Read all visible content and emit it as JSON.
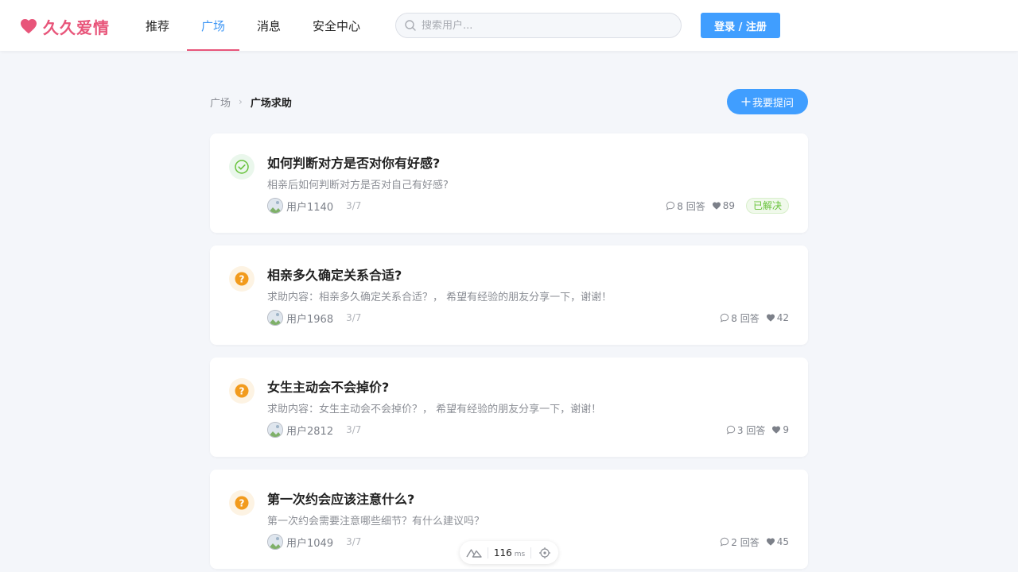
{
  "brand": {
    "name": "久久爱情",
    "color": "#e8557a",
    "icon": "heart-icon"
  },
  "nav": {
    "items": [
      {
        "label": "推荐"
      },
      {
        "label": "广场",
        "active": true
      },
      {
        "label": "消息"
      },
      {
        "label": "安全中心"
      }
    ]
  },
  "search": {
    "placeholder": "搜索用户...",
    "value": ""
  },
  "auth": {
    "login_label": "登录 / 注册"
  },
  "breadcrumb": {
    "root": "广场",
    "current": "广场求助"
  },
  "ask_button": {
    "label": "我要提问"
  },
  "questions": [
    {
      "status": "solved",
      "title": "如何判断对方是否对你有好感?",
      "desc": "相亲后如何判断对方是否对自己有好感?",
      "user": "用户1140",
      "date": "3/7",
      "answers": "8 回答",
      "likes": "89",
      "badge": "已解决"
    },
    {
      "status": "open",
      "title": "相亲多久确定关系合适?",
      "desc": "求助内容：相亲多久确定关系合适？， 希望有经验的朋友分享一下，谢谢！",
      "user": "用户1968",
      "date": "3/7",
      "answers": "8 回答",
      "likes": "42"
    },
    {
      "status": "open",
      "title": "女生主动会不会掉价?",
      "desc": "求助内容：女生主动会不会掉价？， 希望有经验的朋友分享一下，谢谢！",
      "user": "用户2812",
      "date": "3/7",
      "answers": "3 回答",
      "likes": "9"
    },
    {
      "status": "open",
      "title": "第一次约会应该注意什么?",
      "desc": "第一次约会需要注意哪些细节？有什么建议吗？",
      "user": "用户1049",
      "date": "3/7",
      "answers": "2 回答",
      "likes": "45"
    }
  ],
  "perf": {
    "value": "116",
    "unit": "ms"
  },
  "colors": {
    "primary": "#409eff",
    "nav_active": "#3f97f5",
    "solved": "#67c23a",
    "pending": "#f29b1d",
    "page_bg": "#f4f6fa"
  }
}
